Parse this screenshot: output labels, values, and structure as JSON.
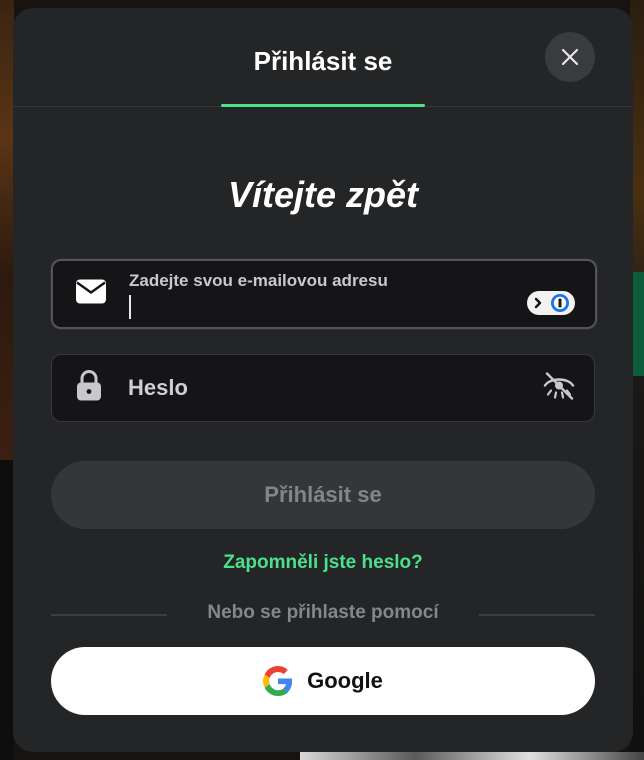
{
  "modal": {
    "tab_title": "Přihlásit se",
    "close_icon": "close-icon",
    "welcome": "Vítejte zpět"
  },
  "email": {
    "icon": "envelope-icon",
    "label": "Zadejte svou e-mailovou adresu",
    "value": "",
    "password_manager_icon": "password-manager-icon"
  },
  "password": {
    "icon": "lock-icon",
    "placeholder": "Heslo",
    "toggle_icon": "eye-slash-icon"
  },
  "actions": {
    "submit_label": "Přihlásit se",
    "forgot_label": "Zapomněli jste heslo?",
    "divider_text": "Nebo se přihlaste pomocí",
    "google_label": "Google",
    "google_icon": "google-icon"
  },
  "colors": {
    "accent": "#4be08a",
    "modal_bg": "#242527",
    "input_bg": "#151517",
    "disabled_button": "#35363a"
  }
}
